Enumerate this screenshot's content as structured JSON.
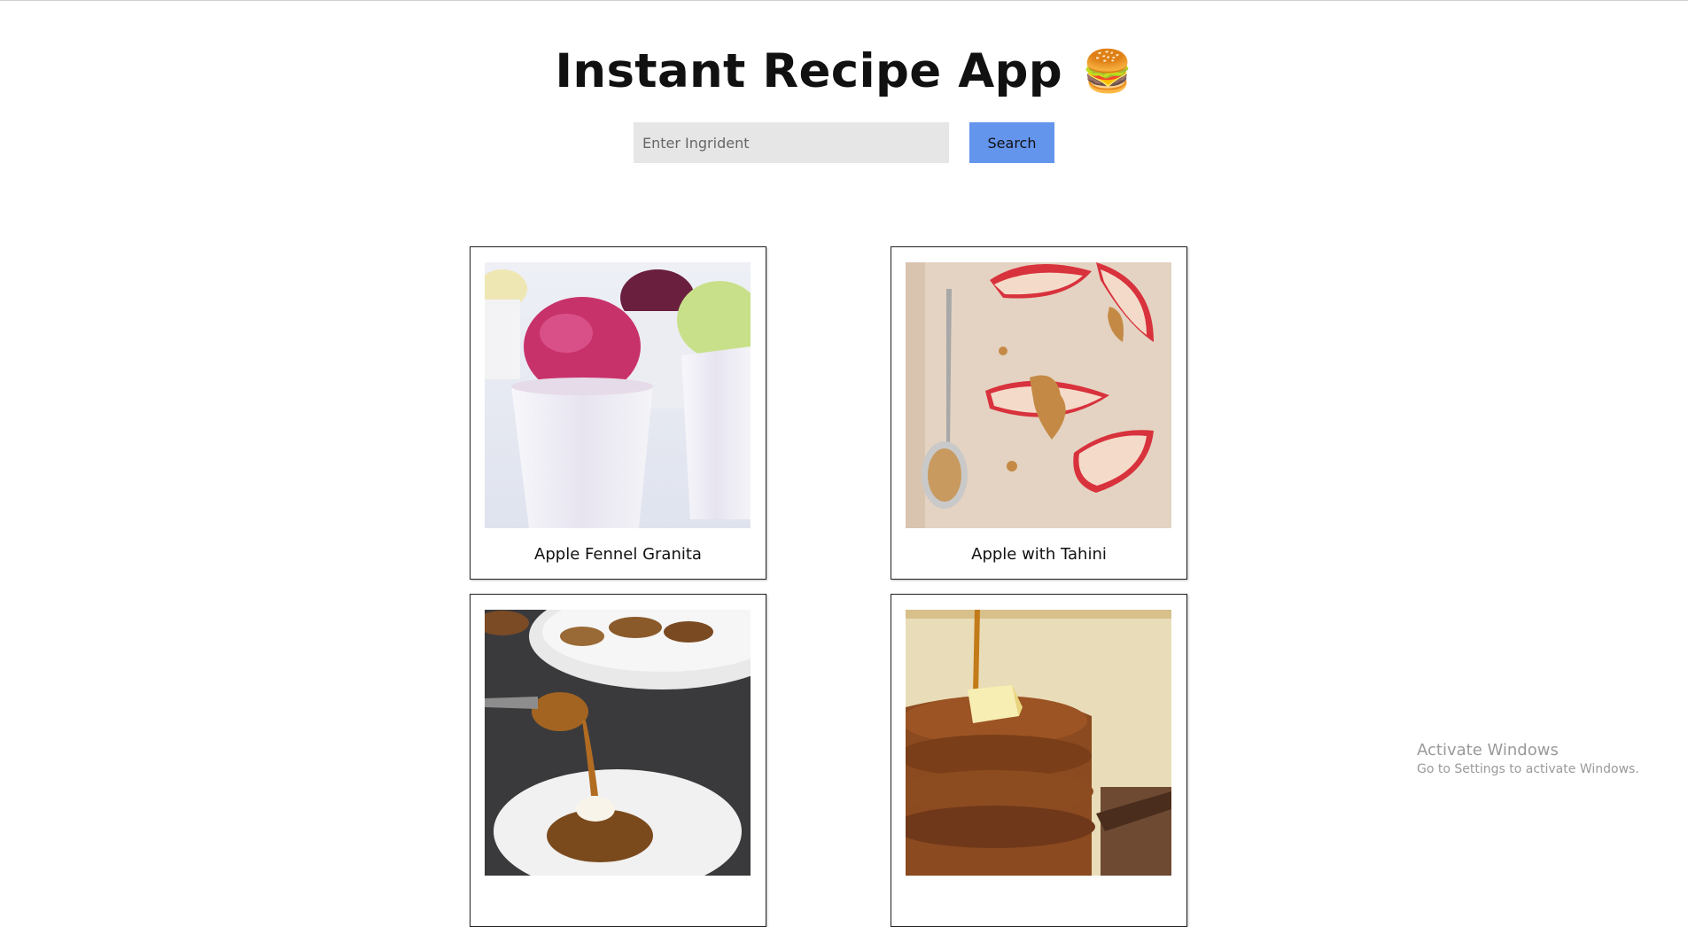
{
  "app": {
    "title": "Instant Recipe App",
    "title_emoji": "🍔"
  },
  "search": {
    "placeholder": "Enter Ingrident",
    "value": "",
    "button_label": "Search",
    "button_color": "#6495ed",
    "input_bg": "#e6e6e6"
  },
  "recipes": [
    {
      "title": "Apple Fennel Granita",
      "image": "granita-cups"
    },
    {
      "title": "Apple with Tahini",
      "image": "apple-slices-tahini"
    },
    {
      "title": "",
      "image": "fritters-caramel"
    },
    {
      "title": "",
      "image": "pancake-stack-syrup"
    }
  ],
  "watermark": {
    "title": "Activate Windows",
    "subtitle": "Go to Settings to activate Windows."
  }
}
